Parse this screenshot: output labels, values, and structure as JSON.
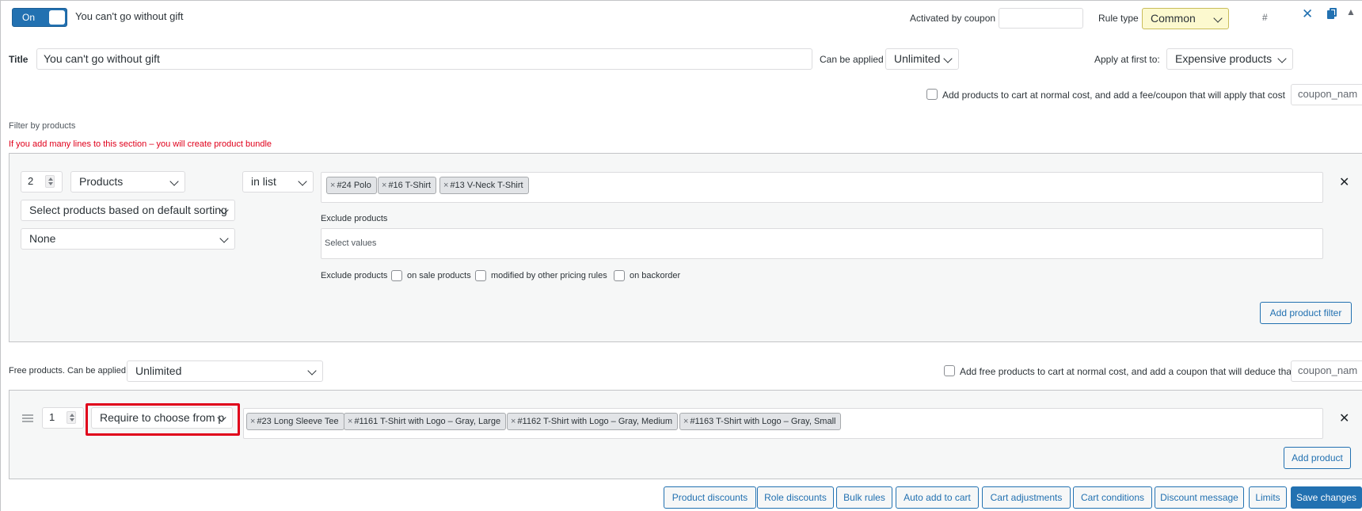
{
  "header": {
    "toggle_label": "On",
    "rule_name": "You can't go without gift",
    "activated_by_coupon_label": "Activated by coupon",
    "activated_by_coupon_value": "",
    "rule_type_label": "Rule type",
    "rule_type_value": "Common",
    "hash_label": "#"
  },
  "title_row": {
    "title_label": "Title",
    "title_value": "You can't go without gift",
    "can_be_applied_label": "Can be applied",
    "can_be_applied_value": "Unlimited",
    "apply_first_label": "Apply at first to:",
    "apply_first_value": "Expensive products"
  },
  "fee_row": {
    "label": "Add products to cart at normal cost, and add a fee/coupon that will apply that cost",
    "coupon_placeholder": "coupon_nam"
  },
  "filter_section": {
    "heading": "Filter by products",
    "warning": "If you add many lines to this section – you will create product bundle",
    "qty": "2",
    "type_value": "Products",
    "method_value": "in list",
    "sorting_value": "Select products based on default sorting",
    "none_value": "None",
    "tags": [
      "#24 Polo",
      "#16 T-Shirt",
      "#13 V-Neck T-Shirt"
    ],
    "exclude_label": "Exclude products",
    "exclude_placeholder": "Select values",
    "exclude_options_label": "Exclude products",
    "opt_on_sale": "on sale products",
    "opt_modified": "modified by other pricing rules",
    "opt_backorder": "on backorder",
    "add_filter_button": "Add product filter"
  },
  "free_section": {
    "label": "Free products. Can be applied",
    "value": "Unlimited",
    "add_free_label": "Add free products to cart at normal cost, and add a coupon that will deduce that cost",
    "coupon_placeholder": "coupon_nam",
    "qty": "1",
    "mode_value": "Require to choose from p",
    "tags": [
      "#23 Long Sleeve Tee",
      "#1161 T-Shirt with Logo – Gray, Large",
      "#1162 T-Shirt with Logo – Gray, Medium",
      "#1163 T-Shirt with Logo – Gray, Small"
    ],
    "add_product_button": "Add product"
  },
  "bottom_buttons": [
    "Product discounts",
    "Role discounts",
    "Bulk rules",
    "Auto add to cart",
    "Cart adjustments",
    "Cart conditions",
    "Discount message",
    "Limits"
  ],
  "save_button": "Save changes",
  "colors": {
    "accent": "#2271b1",
    "warning": "#e0001b",
    "rule_type_bg": "#fcf9cf"
  }
}
